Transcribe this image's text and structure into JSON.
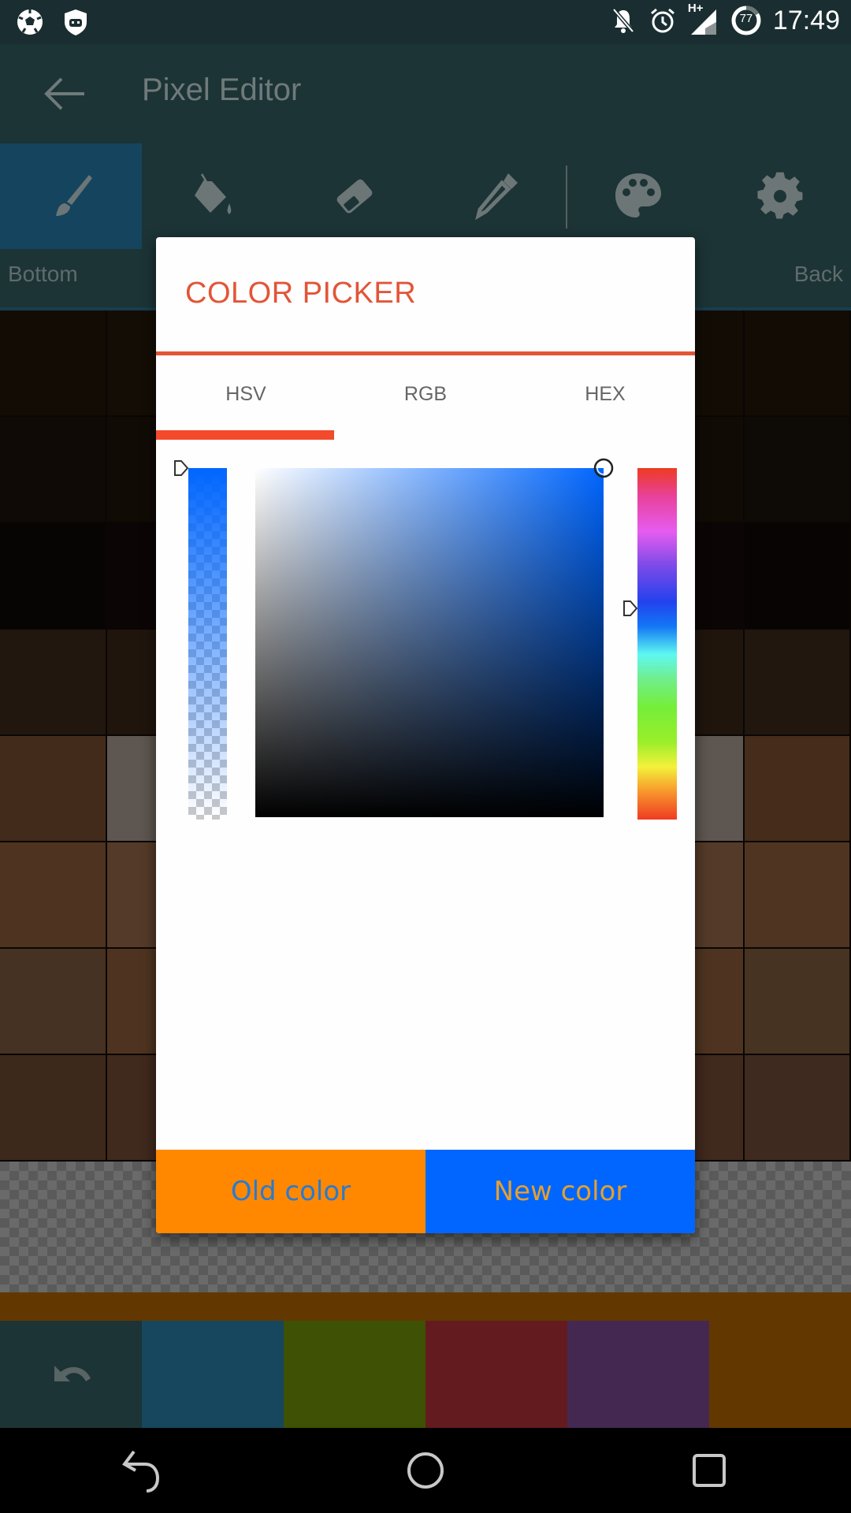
{
  "status_bar": {
    "left_icons": [
      "soccer-ball-icon",
      "cyanogen-shield-icon"
    ],
    "right_icons": [
      "notifications-muted-icon",
      "alarm-icon",
      "signal-hplus-icon",
      "battery-icon"
    ],
    "network_type": "H+",
    "battery_level": "77",
    "time": "17:49"
  },
  "app_bar": {
    "title": "Pixel Editor",
    "back_icon": "arrow-left-icon"
  },
  "toolbar": {
    "tools": [
      {
        "name": "brush",
        "icon": "brush-icon",
        "active": true
      },
      {
        "name": "fill",
        "icon": "paint-bucket-icon",
        "active": false
      },
      {
        "name": "eraser",
        "icon": "eraser-icon",
        "active": false
      },
      {
        "name": "eyedropper",
        "icon": "eyedropper-icon",
        "active": false
      },
      {
        "name": "palette",
        "icon": "palette-icon",
        "active": false
      },
      {
        "name": "settings",
        "icon": "gear-icon",
        "active": false
      }
    ],
    "left_label": "Bottom",
    "right_label": "Back"
  },
  "canvas": {
    "rows": [
      [
        "#120c05",
        "#140d06",
        "#140d06",
        "#130c05",
        "#130c05",
        "#130c05",
        "#130c05",
        "#120c05"
      ],
      [
        "#0f0a06",
        "#110b06",
        "#110b06",
        "#110b06",
        "#110b06",
        "#110b06",
        "#110b06",
        "#0e0b06"
      ],
      [
        "#070404",
        "#0b0605",
        "#0b0605",
        "#0b0605",
        "#0b0605",
        "#0b0605",
        "#0b0605",
        "#080404"
      ],
      [
        "#21170f",
        "#1f150d",
        "#1f150d",
        "#1f150d",
        "#1f150d",
        "#1f150d",
        "#1f150d",
        "#22170f"
      ],
      [
        "#432b1b",
        "#5e5650",
        "#5e5650",
        "#5e5650",
        "#5e5650",
        "#5e5650",
        "#5e5650",
        "#452c1b"
      ],
      [
        "#4e3320",
        "#543a28",
        "#543a28",
        "#543a28",
        "#543a28",
        "#543a28",
        "#543a28",
        "#4f3521"
      ],
      [
        "#463222",
        "#4e3420",
        "#4e3420",
        "#4e3420",
        "#4e3420",
        "#4e3420",
        "#4e3420",
        "#473322"
      ],
      [
        "#3c291c",
        "#40291d",
        "#40291d",
        "#40291d",
        "#40291d",
        "#40291d",
        "#40291d",
        "#3e2a1e"
      ]
    ]
  },
  "palette": {
    "undo_icon": "undo-icon",
    "swatches": [
      "#17475e",
      "#3e5104",
      "#641b1f",
      "#442852"
    ],
    "background": "#633800"
  },
  "nav_bar": {
    "back": "nav-back-icon",
    "home": "nav-home-icon",
    "recents": "nav-recents-icon"
  },
  "dialog": {
    "title": "COLOR PICKER",
    "accent": "#e25537",
    "tabs": [
      {
        "label": "HSV",
        "active": true
      },
      {
        "label": "RGB",
        "active": false
      },
      {
        "label": "HEX",
        "active": false
      }
    ],
    "current_color": "#0066ff",
    "alpha_percent": 100,
    "hue_degrees": 216,
    "saturation_percent": 100,
    "value_percent": 100,
    "old_color_label": "Old color",
    "old_color": "#ff8800",
    "new_color_label": "New color",
    "new_color": "#0066ff"
  }
}
